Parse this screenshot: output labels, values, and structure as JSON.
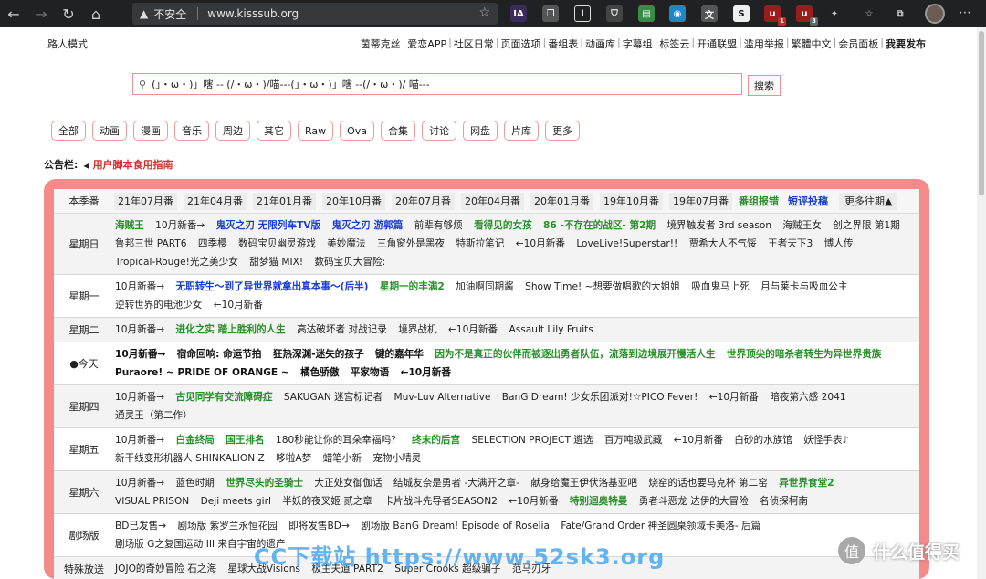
{
  "browser": {
    "insecure": "不安全",
    "url": "www.kisssub.org",
    "ext_badge_1": "1",
    "ext_badge_2": "3"
  },
  "mode": "路人模式",
  "nav": [
    "茵蒂克丝",
    "爱恋APP",
    "社区日常",
    "页面选项",
    "番组表",
    "动画库",
    "字幕组",
    "标签云",
    "开通联盟",
    "滥用举报",
    "繁體中文",
    "会员面板",
    "我要发布"
  ],
  "search": {
    "value": "(」・ω・)」嗐 -- (/・ω・)/喵---(」・ω・)」嗐 --(/・ω・)/ 喵---",
    "button": "搜索"
  },
  "categories": [
    "全部",
    "动画",
    "漫画",
    "音乐",
    "周边",
    "其它",
    "Raw",
    "Ova",
    "合集",
    "讨论",
    "网盘",
    "片库",
    "更多"
  ],
  "notice": {
    "label": "公告栏:",
    "link": "用户脚本食用指南"
  },
  "season": {
    "label": "本季番",
    "items": [
      "21年07月番",
      "21年04月番",
      "21年01月番",
      "20年10月番",
      "20年07月番",
      "20年04月番",
      "20年01月番",
      "19年10月番",
      "19年07月番"
    ],
    "report": "番组报错",
    "review": "短评投稿",
    "more": "更多往期▲"
  },
  "schedule": [
    {
      "day": "星期日",
      "items": [
        {
          "t": "海贼王",
          "c": "green"
        },
        {
          "t": "10月新番→",
          "c": ""
        },
        {
          "t": "鬼灭之刃 无限列车TV版",
          "c": "blue"
        },
        {
          "t": "鬼灭之刃 游郭篇",
          "c": "blue"
        },
        {
          "t": "前辈有够烦",
          "c": ""
        },
        {
          "t": "看得见的女孩",
          "c": "green"
        },
        {
          "t": "86 -不存在的战区- 第2期",
          "c": "green"
        },
        {
          "t": "境界触发者 3rd season",
          "c": ""
        },
        {
          "t": "海贼王女",
          "c": ""
        },
        {
          "t": "创之界限 第1期",
          "c": ""
        },
        {
          "t": "鲁邦三世 PART6",
          "c": ""
        },
        {
          "t": "四季樱",
          "c": ""
        },
        {
          "t": "数码宝贝幽灵游戏",
          "c": ""
        },
        {
          "t": "美妙魔法",
          "c": ""
        },
        {
          "t": "三角窗外是黑夜",
          "c": ""
        },
        {
          "t": "特斯拉笔记",
          "c": ""
        },
        {
          "t": "←10月新番",
          "c": ""
        },
        {
          "t": "LoveLive!Superstar!!",
          "c": ""
        },
        {
          "t": "贾希大人不气馁",
          "c": ""
        },
        {
          "t": "王者天下3",
          "c": ""
        },
        {
          "t": "博人传",
          "c": ""
        },
        {
          "t": "Tropical-Rouge!光之美少女",
          "c": ""
        },
        {
          "t": "甜梦猫 MIX!",
          "c": ""
        },
        {
          "t": "数码宝贝大冒险:",
          "c": ""
        }
      ]
    },
    {
      "day": "星期一",
      "items": [
        {
          "t": "10月新番→",
          "c": ""
        },
        {
          "t": "无职转生～到了异世界就拿出真本事～(后半)",
          "c": "blue"
        },
        {
          "t": "星期一的丰满2",
          "c": "green"
        },
        {
          "t": "加油啊同期酱",
          "c": ""
        },
        {
          "t": "Show Time! ~想要做唱歌的大姐姐",
          "c": ""
        },
        {
          "t": "吸血鬼马上死",
          "c": ""
        },
        {
          "t": "月与莱卡与吸血公主",
          "c": ""
        },
        {
          "t": "逆转世界的电池少女",
          "c": ""
        },
        {
          "t": "←10月新番",
          "c": ""
        }
      ]
    },
    {
      "day": "星期二",
      "items": [
        {
          "t": "10月新番→",
          "c": ""
        },
        {
          "t": "进化之实 踏上胜利的人生",
          "c": "green"
        },
        {
          "t": "高达破坏者 对战记录",
          "c": ""
        },
        {
          "t": "境界战机",
          "c": ""
        },
        {
          "t": "←10月新番",
          "c": ""
        },
        {
          "t": "Assault Lily Fruits",
          "c": ""
        }
      ]
    },
    {
      "day": "●今天",
      "items": [
        {
          "t": "10月新番→",
          "c": "dark"
        },
        {
          "t": "宿命回响: 命运节拍",
          "c": "dark"
        },
        {
          "t": "狂热深渊-迷失的孩子",
          "c": "dark"
        },
        {
          "t": "键的嘉年华",
          "c": "dark"
        },
        {
          "t": "因为不是真正的伙伴而被逐出勇者队伍，流落到边境展开慢活人生",
          "c": "green"
        },
        {
          "t": "世界顶尖的暗杀者转生为异世界贵族",
          "c": "green"
        },
        {
          "t": "Puraore! ~ PRIDE OF ORANGE ~",
          "c": "dark"
        },
        {
          "t": "橘色骄傲",
          "c": "dark"
        },
        {
          "t": "平家物语",
          "c": "dark"
        },
        {
          "t": "←10月新番",
          "c": "dark"
        }
      ]
    },
    {
      "day": "星期四",
      "items": [
        {
          "t": "10月新番→",
          "c": ""
        },
        {
          "t": "古见同学有交流障碍症",
          "c": "green"
        },
        {
          "t": "SAKUGAN 迷宫标记者",
          "c": ""
        },
        {
          "t": "Muv-Luv Alternative",
          "c": ""
        },
        {
          "t": "BanG Dream! 少女乐团派对!☆PICO Fever!",
          "c": ""
        },
        {
          "t": "←10月新番",
          "c": ""
        },
        {
          "t": "暗夜第六感 2041",
          "c": ""
        },
        {
          "t": "通灵王（第二作）",
          "c": ""
        }
      ]
    },
    {
      "day": "星期五",
      "items": [
        {
          "t": "10月新番→",
          "c": ""
        },
        {
          "t": "白金终局",
          "c": "green"
        },
        {
          "t": "国王排名",
          "c": "green"
        },
        {
          "t": "180秒能让你的耳朵幸福吗？",
          "c": ""
        },
        {
          "t": "终末的后宫",
          "c": "green"
        },
        {
          "t": "SELECTION PROJECT 遴选",
          "c": ""
        },
        {
          "t": "百万吨级武藏",
          "c": ""
        },
        {
          "t": "←10月新番",
          "c": ""
        },
        {
          "t": "白砂的水族馆",
          "c": ""
        },
        {
          "t": "妖怪手表♪",
          "c": ""
        },
        {
          "t": "新干线变形机器人 SHINKALION Z",
          "c": ""
        },
        {
          "t": "哆啦A梦",
          "c": ""
        },
        {
          "t": "蜡笔小新",
          "c": ""
        },
        {
          "t": "宠物小精灵",
          "c": ""
        }
      ]
    },
    {
      "day": "星期六",
      "items": [
        {
          "t": "10月新番→",
          "c": ""
        },
        {
          "t": "蓝色时期",
          "c": ""
        },
        {
          "t": "世界尽头的圣骑士",
          "c": "green"
        },
        {
          "t": "大正处女御伽话",
          "c": ""
        },
        {
          "t": "结城友奈是勇者 -大满开之章-",
          "c": ""
        },
        {
          "t": "献身给魔王伊伏洛基亚吧",
          "c": ""
        },
        {
          "t": "烧窑的话也要马克杯 第二窑",
          "c": ""
        },
        {
          "t": "异世界食堂2",
          "c": "green"
        },
        {
          "t": "VISUAL PRISON",
          "c": ""
        },
        {
          "t": "Deji meets girl",
          "c": ""
        },
        {
          "t": "半妖的夜叉姬 贰之章",
          "c": ""
        },
        {
          "t": "卡片战斗先导者SEASON2",
          "c": ""
        },
        {
          "t": "←10月新番",
          "c": ""
        },
        {
          "t": "特别迴奥特曼",
          "c": "green"
        },
        {
          "t": "勇者斗恶龙 达伊的大冒险",
          "c": ""
        },
        {
          "t": "名侦探柯南",
          "c": ""
        }
      ]
    },
    {
      "day": "剧场版",
      "items": [
        {
          "t": "BD已发售→",
          "c": ""
        },
        {
          "t": "剧场版 紫罗兰永恒花园",
          "c": ""
        },
        {
          "t": "即将发售BD→",
          "c": ""
        },
        {
          "t": "剧场版 BanG Dream! Episode of Roselia",
          "c": ""
        },
        {
          "t": "Fate/Grand Order 神圣圆桌领域卡美洛- 后篇",
          "c": ""
        },
        {
          "t": "剧场版 G之复国运动 III 来自宇宙的遗产",
          "c": ""
        }
      ]
    },
    {
      "day": "特殊放送",
      "items": [
        {
          "t": "JOJO的奇妙冒险 石之海",
          "c": ""
        },
        {
          "t": "星球大战Visions",
          "c": ""
        },
        {
          "t": "极主夫道 PART2",
          "c": ""
        },
        {
          "t": "Super Crooks 超级骗子",
          "c": ""
        },
        {
          "t": "范马刃牙",
          "c": ""
        }
      ]
    }
  ],
  "watermark": {
    "main": "CC下载站 https://www.52sk3.org",
    "brand": "什么值得买",
    "brand_icon": "值"
  }
}
